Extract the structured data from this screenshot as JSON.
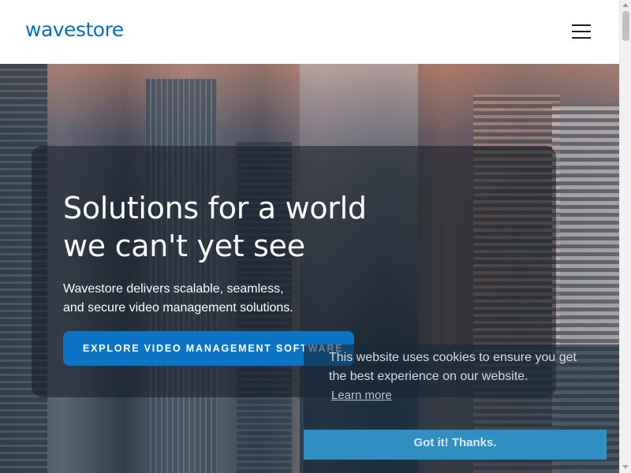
{
  "header": {
    "logo_text": "wavestore",
    "menu_icon": "hamburger-menu-icon"
  },
  "hero": {
    "headline_line1": "Solutions for a world",
    "headline_line2": "we can't yet see",
    "subline_line1": "Wavestore delivers scalable, seamless,",
    "subline_line2": "and secure video management solutions.",
    "cta_label": "EXPLORE VIDEO MANAGEMENT SOFTWARE"
  },
  "cookie_banner": {
    "message": "This website uses cookies to ensure you get the best experience on our website.",
    "learn_more": "Learn more",
    "accept_label": "Got it! Thanks."
  },
  "colors": {
    "brand_blue": "#0a6fb5",
    "cta_blue": "#0b74c4",
    "cookie_button": "#2e8fc0"
  }
}
